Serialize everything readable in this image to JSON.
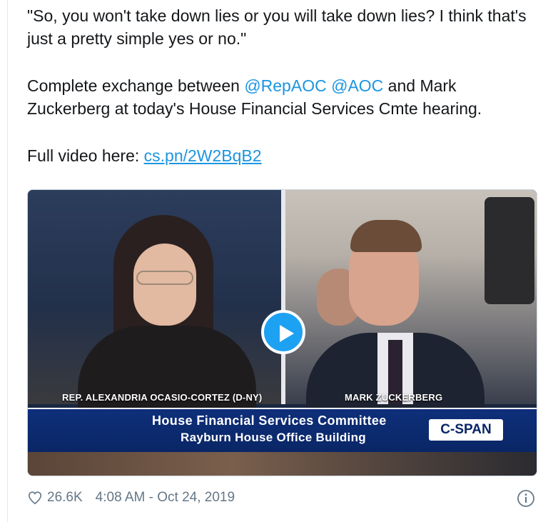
{
  "tweet": {
    "quote": "\"So, you won't take down lies or you will take down lies? I think that's just a pretty simple yes or no.\"",
    "exchange_prefix": "Complete exchange between ",
    "mention1": "@RepAOC",
    "mention2": "@AOC",
    "exchange_suffix": " and Mark Zuckerberg at today's House Financial Services Cmte hearing.",
    "video_prefix": "Full video here: ",
    "video_link": "cs.pn/2W2BqB2"
  },
  "media": {
    "left_caption": "REP. ALEXANDRIA OCASIO-CORTEZ (D-NY)",
    "right_caption": "MARK ZUCKERBERG",
    "banner_line1": "House Financial Services Committee",
    "banner_line2": "Rayburn House Office Building",
    "logo": "C-SPAN",
    "play_icon": "play-icon"
  },
  "footer": {
    "likes": "26.6K",
    "timestamp": "4:08 AM - Oct 24, 2019",
    "like_icon": "heart-icon",
    "info_icon": "info-icon"
  },
  "colors": {
    "link": "#1b95e0",
    "play": "#1da1f2",
    "banner": "#0a2666",
    "meta_text": "#657786"
  }
}
